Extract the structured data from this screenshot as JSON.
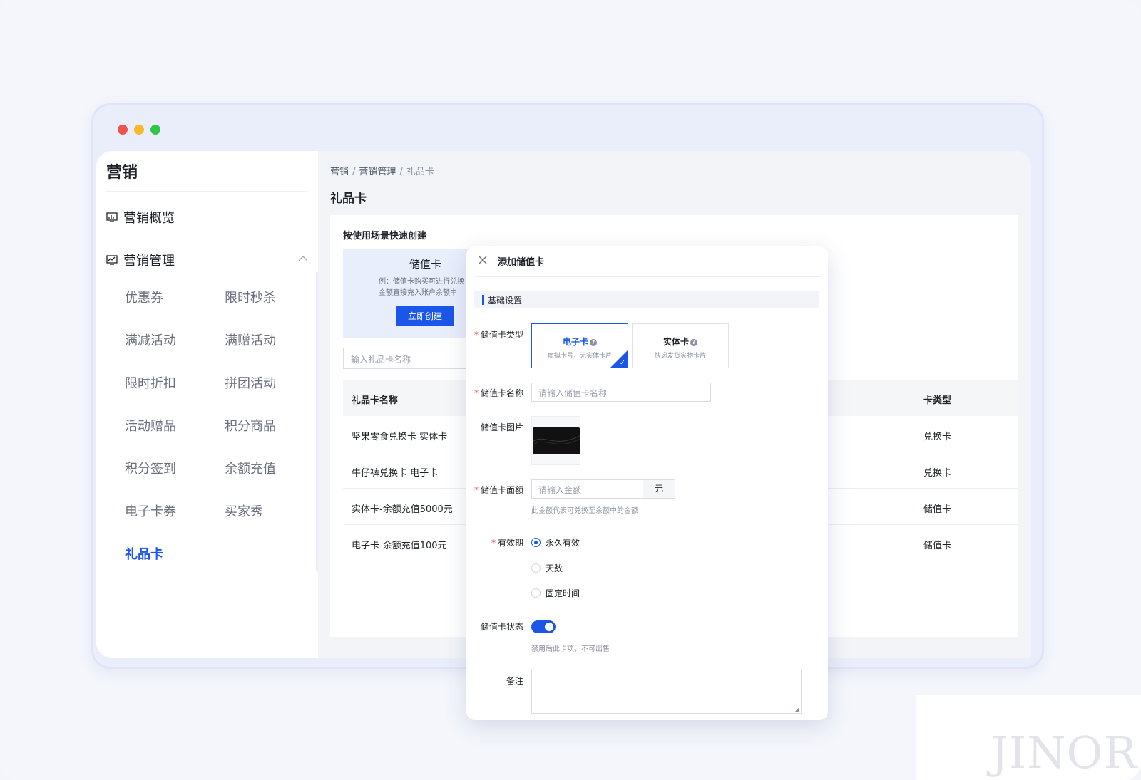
{
  "sidebar": {
    "title": "营销",
    "overview": "营销概览",
    "management": "营销管理",
    "sub_items": [
      "优惠券",
      "限时秒杀",
      "满减活动",
      "满赠活动",
      "限时折扣",
      "拼团活动",
      "活动赠品",
      "积分商品",
      "积分签到",
      "余额充值",
      "电子卡券",
      "买家秀",
      "礼品卡"
    ],
    "active_item": "礼品卡"
  },
  "breadcrumb": [
    "营销",
    "营销管理",
    "礼品卡"
  ],
  "page_title": "礼品卡",
  "quick_create": {
    "title": "按使用场景快速创建",
    "card_name": "储值卡",
    "card_desc_1": "例：储值卡购买可进行兑换",
    "card_desc_2": "金额直接充入账户余额中",
    "button": "立即创建"
  },
  "search": {
    "placeholder": "输入礼品卡名称"
  },
  "table": {
    "columns": [
      "礼品卡名称",
      "卡类型"
    ],
    "rows": [
      [
        "坚果零食兑换卡 实体卡",
        "兑换卡"
      ],
      [
        "牛仔裤兑换卡 电子卡",
        "兑换卡"
      ],
      [
        "实体卡-余额充值5000元",
        "储值卡"
      ],
      [
        "电子卡-余额充值100元",
        "储值卡"
      ]
    ]
  },
  "modal": {
    "title": "添加储值卡",
    "section": "基础设置",
    "type_label": "储值卡类型",
    "types": [
      {
        "name": "电子卡",
        "desc": "虚拟卡号，无实体卡片",
        "selected": true
      },
      {
        "name": "实体卡",
        "desc": "快递发货实物卡片",
        "selected": false
      }
    ],
    "name_label": "储值卡名称",
    "name_placeholder": "请输入储值卡名称",
    "image_label": "储值卡图片",
    "amount_label": "储值卡面额",
    "amount_placeholder": "请输入金额",
    "amount_unit": "元",
    "amount_hint": "此金额代表可兑换至余额中的金额",
    "validity_label": "有效期",
    "validity_options": [
      "永久有效",
      "天数",
      "固定时间"
    ],
    "validity_selected": "永久有效",
    "status_label": "储值卡状态",
    "status_on": true,
    "status_hint": "禁用后此卡项，不可出售",
    "remark_label": "备注"
  },
  "watermark": "JINOR",
  "colors": {
    "accent": "#1a56e8",
    "required": "#e5484d"
  }
}
